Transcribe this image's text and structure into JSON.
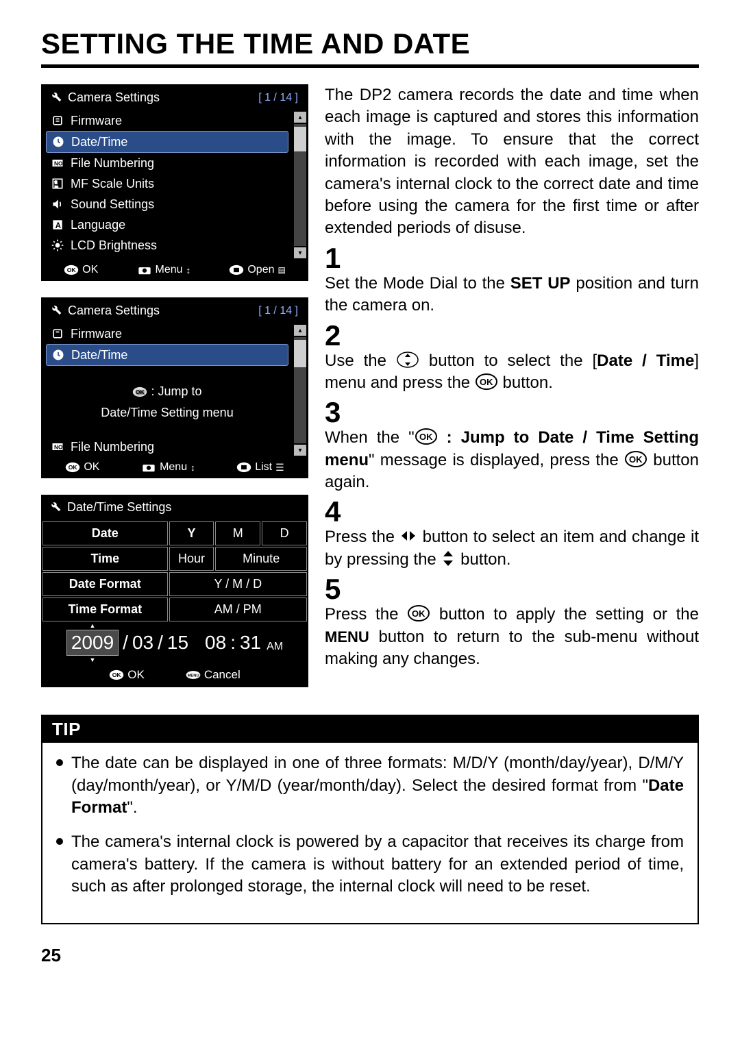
{
  "title": "SETTING THE TIME AND DATE",
  "intro": "The DP2 camera records the date and time when each image is captured and stores this information with the image. To ensure that the correct information is recorded with each image, set the camera's internal clock to the correct date and time before using the camera for the first time or after extended periods of disuse.",
  "steps": {
    "s1": {
      "num": "1",
      "text_a": "Set the Mode Dial to the ",
      "bold": "SET UP",
      "text_b": " position and turn the camera on."
    },
    "s2": {
      "num": "2",
      "text_a": "Use the ",
      "text_b": " button to select the [",
      "bold": "Date / Time",
      "text_c": "] menu and press the ",
      "text_d": " button."
    },
    "s3": {
      "num": "3",
      "text_a": "When the \"",
      "bold": " : Jump to Date / Time Setting menu",
      "text_b": "\" message is displayed, press the ",
      "text_c": " button again."
    },
    "s4": {
      "num": "4",
      "text_a": "Press the ",
      "text_b": " button to select an item and change it by pressing the ",
      "text_c": " button."
    },
    "s5": {
      "num": "5",
      "text_a": "Press the ",
      "text_b": " button to apply the setting or the ",
      "menu": "MENU",
      "text_c": " button to return to the sub-menu without making any changes."
    }
  },
  "panel1": {
    "title": "Camera Settings",
    "page": "[  1  / 14 ]",
    "items": [
      "Firmware",
      "Date/Time",
      "File Numbering",
      "MF Scale Units",
      "Sound Settings",
      "Language",
      "LCD Brightness"
    ],
    "footer": {
      "ok": "OK",
      "menu": "Menu",
      "open": "Open"
    }
  },
  "panel2": {
    "title": "Camera Settings",
    "page": "[  1  / 14 ]",
    "items_top": [
      "Firmware",
      "Date/Time"
    ],
    "jump_l1": " : Jump to",
    "jump_l2": "Date/Time Setting menu",
    "item_bottom": "File Numbering",
    "footer": {
      "ok": "OK",
      "menu": "Menu",
      "list": "List"
    }
  },
  "panel3": {
    "title": "Date/Time Settings",
    "rows": {
      "date": {
        "label": "Date",
        "y": "Y",
        "m": "M",
        "d": "D"
      },
      "time": {
        "label": "Time",
        "hour": "Hour",
        "minute": "Minute"
      },
      "dateformat": {
        "label": "Date Format",
        "val": "Y / M / D"
      },
      "timeformat": {
        "label": "Time Format",
        "val": "AM / PM"
      }
    },
    "value": {
      "year": "2009",
      "sep1": " / ",
      "month": "03",
      "sep2": " / ",
      "day": "15",
      "hour": "08",
      "tsep": " : ",
      "minute": "31",
      "ampm": "AM"
    },
    "footer": {
      "ok": "OK",
      "cancel": "Cancel"
    }
  },
  "tip": {
    "head": "TIP",
    "b1_a": "The date can be displayed in one of three formats: M/D/Y (month/day/year), D/M/Y (day/month/year), or Y/M/D (year/month/day). Select the desired format from \"",
    "b1_bold": "Date Format",
    "b1_b": "\".",
    "b2": "The camera's internal clock is powered by a capacitor that receives its charge from  camera's battery.  If the camera is without battery for an extended period of time, such as after prolonged storage, the internal clock will need to be reset."
  },
  "page_number": "25"
}
